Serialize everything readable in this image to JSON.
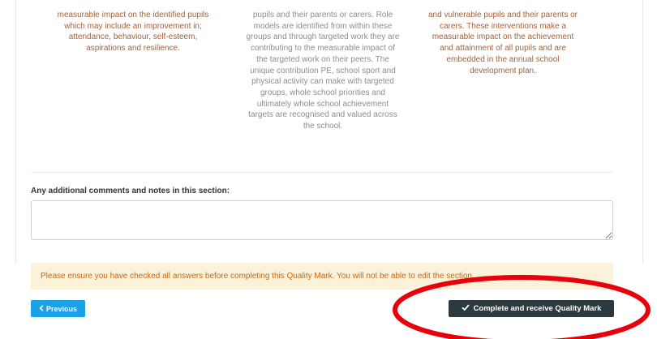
{
  "columns": [
    {
      "lines": [
        "measurable impact on the identified pupils",
        "which may include an improvement in;",
        "attendance, behaviour, self-esteem,",
        "aspirations and resilience."
      ]
    },
    {
      "lines": [
        "pupils and their parents or carers. Role",
        "models are identified from within these",
        "groups and through targeted work they are",
        "contributing to the measurable impact of",
        "the targeted work on their peers. The",
        "unique contribution PE, school sport and",
        "physical activity can make with targeted",
        "groups, whole school priorities and",
        "ultimately whole school achievement",
        "targets are recognised and valued across",
        "the school."
      ]
    },
    {
      "lines": [
        "and vulnerable pupils and their parents or",
        "carers. These interventions make a",
        "measurable impact on the achievement",
        "and attainment of all pupils and are",
        "embedded in the annual school",
        "development plan."
      ]
    }
  ],
  "comments": {
    "label": "Any additional comments and notes in this section:",
    "value": ""
  },
  "notice": {
    "text": "Please ensure you have checked all answers before completing this Quality Mark. You will not be able to edit the section."
  },
  "buttons": {
    "previous_label": "Previous",
    "complete_label": "Complete and receive Quality Mark"
  },
  "icons": {
    "previous": "chevron-left-icon",
    "complete": "check-icon"
  },
  "colors": {
    "accent_blue": "#1aa1e6",
    "dark_button": "#2c3a40",
    "notice_bg": "#fcf2da",
    "notice_text": "#c06a1a",
    "highlight_text": "#a3623a",
    "annotation_red": "#e8000b"
  }
}
